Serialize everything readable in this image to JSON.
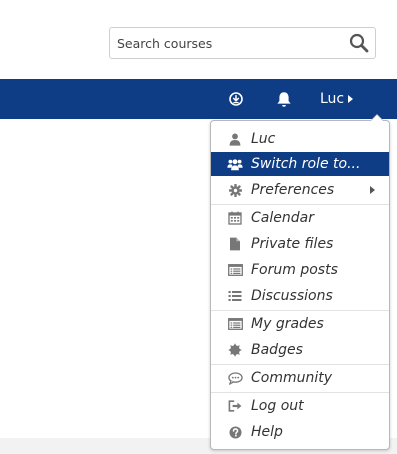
{
  "search": {
    "placeholder": "Search courses",
    "icon": "search-icon"
  },
  "navbar": {
    "background": "#0f3d85",
    "icons": [
      "messages-icon",
      "bell-icon"
    ],
    "user_label": "Luc"
  },
  "user_menu": {
    "active_background": "#0f3d85",
    "items": [
      {
        "label": "Luc",
        "icon": "user-icon"
      },
      {
        "label": "Switch role to...",
        "icon": "users-icon",
        "active": true
      },
      {
        "label": "Preferences",
        "icon": "gear-icon",
        "has_submenu": true
      },
      {
        "label": "Calendar",
        "icon": "calendar-icon"
      },
      {
        "label": "Private files",
        "icon": "file-icon"
      },
      {
        "label": "Forum posts",
        "icon": "list-alt-icon"
      },
      {
        "label": "Discussions",
        "icon": "list-icon"
      },
      {
        "label": "My grades",
        "icon": "list-alt-icon"
      },
      {
        "label": "Badges",
        "icon": "certificate-icon"
      },
      {
        "label": "Community",
        "icon": "comment-icon"
      },
      {
        "label": "Log out",
        "icon": "sign-out-icon"
      },
      {
        "label": "Help",
        "icon": "question-circle-icon"
      }
    ]
  }
}
